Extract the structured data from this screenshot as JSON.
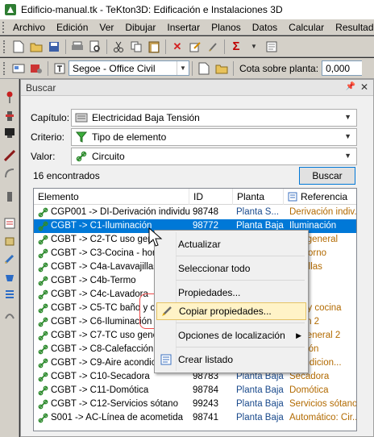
{
  "window": {
    "title": "Edificio-manual.tk - TeKton3D: Edificación e Instalaciones 3D"
  },
  "menu": [
    "Archivo",
    "Edición",
    "Ver",
    "Dibujar",
    "Insertar",
    "Planos",
    "Datos",
    "Calcular",
    "Resultado"
  ],
  "toolbar2": {
    "font": "Segoe - Office Civil",
    "cota_label": "Cota sobre planta:",
    "cota_value": "0,000"
  },
  "panel": {
    "title": "Buscar",
    "capitulo_label": "Capítulo:",
    "capitulo_value": "Electricidad Baja Tensión",
    "criterio_label": "Criterio:",
    "criterio_value": "Tipo de elemento",
    "valor_label": "Valor:",
    "valor_value": "Circuito",
    "count": "16 encontrados",
    "buscar_button": "Buscar"
  },
  "table": {
    "headers": [
      "Elemento",
      "ID",
      "Planta",
      "Referencia"
    ],
    "rows": [
      {
        "elemento": "CGP001 -> DI-Derivación individual",
        "id": "98748",
        "planta": "Planta S...",
        "referencia": "Derivación indiv..."
      },
      {
        "elemento": "CGBT -> C1-Iluminación",
        "id": "98772",
        "planta": "Planta Baja",
        "referencia": "Iluminación",
        "selected": true
      },
      {
        "elemento": "CGBT -> C2-TC uso general",
        "id": "",
        "planta": "",
        "referencia": "uso general"
      },
      {
        "elemento": "CGBT -> C3-Cocina - horno",
        "id": "",
        "planta": "",
        "referencia": "a - horno"
      },
      {
        "elemento": "CGBT -> C4a-Lavavajillas",
        "id": "",
        "planta": "",
        "referencia": "avajillas"
      },
      {
        "elemento": "CGBT -> C4b-Termo",
        "id": "",
        "planta": "",
        "referencia": "o"
      },
      {
        "elemento": "CGBT -> C4c-Lavadora",
        "id": "",
        "planta": "",
        "referencia": "dora"
      },
      {
        "elemento": "CGBT -> C5-TC baño y cocina",
        "id": "",
        "planta": "",
        "referencia": "año y cocina"
      },
      {
        "elemento": "CGBT -> C6-Iluminación 2",
        "id": "",
        "planta": "",
        "referencia": "ación 2"
      },
      {
        "elemento": "CGBT -> C7-TC uso general 2",
        "id": "",
        "planta": "",
        "referencia": "so general 2"
      },
      {
        "elemento": "CGBT -> C8-Calefacción",
        "id": "",
        "planta": "",
        "referencia": "facción"
      },
      {
        "elemento": "CGBT -> C9-Aire acondicionado",
        "id": "",
        "planta": "",
        "referencia": "acondicion..."
      },
      {
        "elemento": "CGBT -> C10-Secadora",
        "id": "98783",
        "planta": "Planta Baja",
        "referencia": "Secadora"
      },
      {
        "elemento": "CGBT -> C11-Domótica",
        "id": "98784",
        "planta": "Planta Baja",
        "referencia": "Domótica"
      },
      {
        "elemento": "CGBT -> C12-Servicios sótano",
        "id": "99243",
        "planta": "Planta Baja",
        "referencia": "Servicios sótano"
      },
      {
        "elemento": "S001 -> AC-Línea de acometida",
        "id": "98741",
        "planta": "Planta Baja",
        "referencia": "Automático: Cir..."
      }
    ]
  },
  "context_menu": {
    "items": [
      {
        "label": "Actualizar"
      },
      {
        "label": "Seleccionar todo"
      },
      {
        "label": "Propiedades..."
      },
      {
        "label": "Copiar propiedades..."
      },
      {
        "label": "Opciones de localización"
      },
      {
        "label": "Crear listado"
      }
    ]
  },
  "colors": {
    "selection": "#0078d7",
    "highlight_box": "#ef4a4a",
    "circuit_icon": "#2e8b2e",
    "menu_hover": "#fff3c7"
  }
}
